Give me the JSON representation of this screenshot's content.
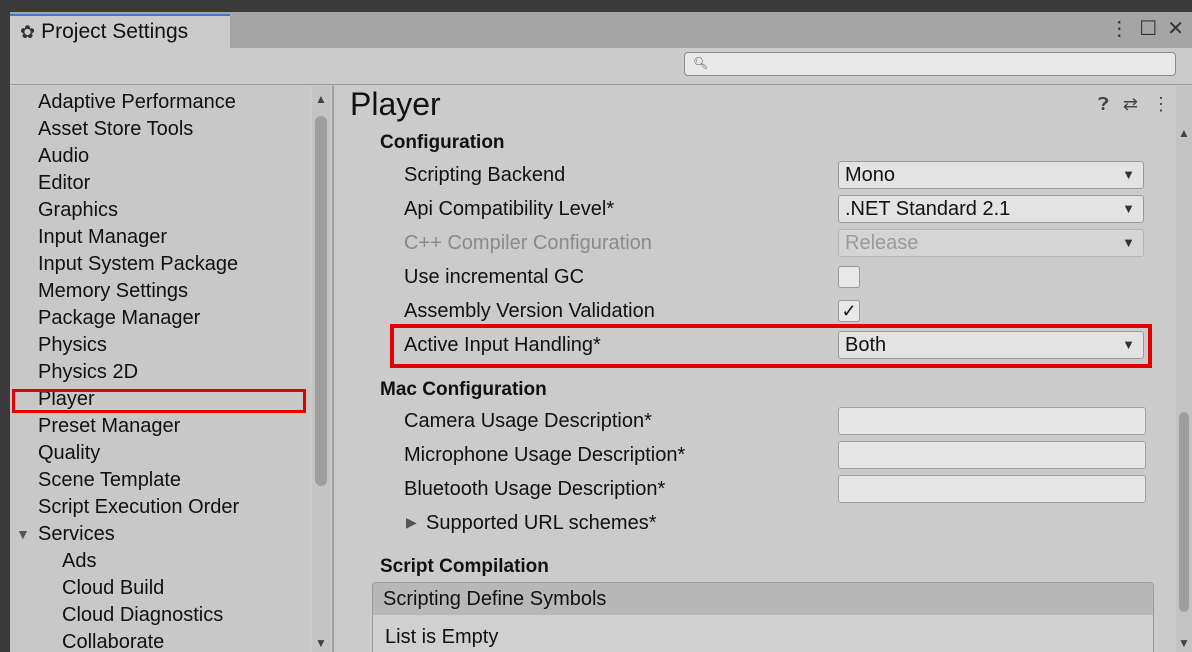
{
  "window": {
    "tab_title": "Project Settings",
    "controls": [
      "⋮",
      "☐",
      "✕"
    ]
  },
  "search": {
    "placeholder": ""
  },
  "sidebar": {
    "items": [
      {
        "label": "Adaptive Performance"
      },
      {
        "label": "Asset Store Tools"
      },
      {
        "label": "Audio"
      },
      {
        "label": "Editor"
      },
      {
        "label": "Graphics"
      },
      {
        "label": "Input Manager"
      },
      {
        "label": "Input System Package"
      },
      {
        "label": "Memory Settings"
      },
      {
        "label": "Package Manager"
      },
      {
        "label": "Physics"
      },
      {
        "label": "Physics 2D"
      },
      {
        "label": "Player"
      },
      {
        "label": "Preset Manager"
      },
      {
        "label": "Quality"
      },
      {
        "label": "Scene Template"
      },
      {
        "label": "Script Execution Order"
      },
      {
        "label": "Services"
      },
      {
        "label": "Ads"
      },
      {
        "label": "Cloud Build"
      },
      {
        "label": "Cloud Diagnostics"
      },
      {
        "label": "Collaborate"
      }
    ],
    "selected": "Player"
  },
  "main": {
    "title": "Player",
    "configuration": {
      "heading": "Configuration",
      "scripting_backend": {
        "label": "Scripting Backend",
        "value": "Mono"
      },
      "api_compat": {
        "label": "Api Compatibility Level*",
        "value": ".NET Standard 2.1"
      },
      "cpp_compiler": {
        "label": "C++ Compiler Configuration",
        "value": "Release"
      },
      "incremental_gc": {
        "label": "Use incremental GC",
        "checked": false
      },
      "assembly_validation": {
        "label": "Assembly Version Validation",
        "checked": true,
        "mark": "✓"
      },
      "active_input": {
        "label": "Active Input Handling*",
        "value": "Both"
      }
    },
    "mac_configuration": {
      "heading": "Mac Configuration",
      "camera": {
        "label": "Camera Usage Description*",
        "value": ""
      },
      "microphone": {
        "label": "Microphone Usage Description*",
        "value": ""
      },
      "bluetooth": {
        "label": "Bluetooth Usage Description*",
        "value": ""
      },
      "url_schemes": {
        "label": "Supported URL schemes*"
      }
    },
    "script_compilation": {
      "heading": "Script Compilation",
      "define_symbols_header": "Scripting Define Symbols",
      "empty_text": "List is Empty"
    }
  },
  "colors": {
    "highlight": "#e00000",
    "tab_accent": "#3a7bd5"
  },
  "icons": [
    "gear-icon",
    "help-icon",
    "presets-icon",
    "kebab-menu-icon",
    "search-icon",
    "dropdown-arrow-icon",
    "foldout-arrow-icon"
  ]
}
